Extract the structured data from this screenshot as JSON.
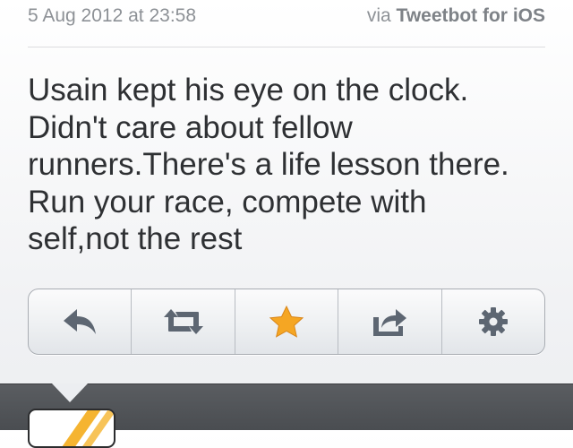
{
  "tweet": {
    "timestamp": "5 Aug 2012 at 23:58",
    "via_prefix": "via",
    "via_client": "Tweetbot for iOS",
    "text": "Usain kept his eye on the clock. Didn't care about fellow runners.There's a life lesson there. Run your race, compete with self,not the rest"
  },
  "actions": [
    {
      "name": "reply",
      "icon": "reply-icon",
      "color": "#5d6672"
    },
    {
      "name": "retweet",
      "icon": "retweet-icon",
      "color": "#5d6672"
    },
    {
      "name": "favorite",
      "icon": "star-icon",
      "color": "#f5a623",
      "active": true
    },
    {
      "name": "share",
      "icon": "share-icon",
      "color": "#5d6672"
    },
    {
      "name": "settings",
      "icon": "gear-icon",
      "color": "#5d6672"
    }
  ],
  "colors": {
    "meta_text": "#8d9196",
    "tweet_text": "#2e3033",
    "panel_dark": "#505357",
    "star": "#f5a623"
  }
}
